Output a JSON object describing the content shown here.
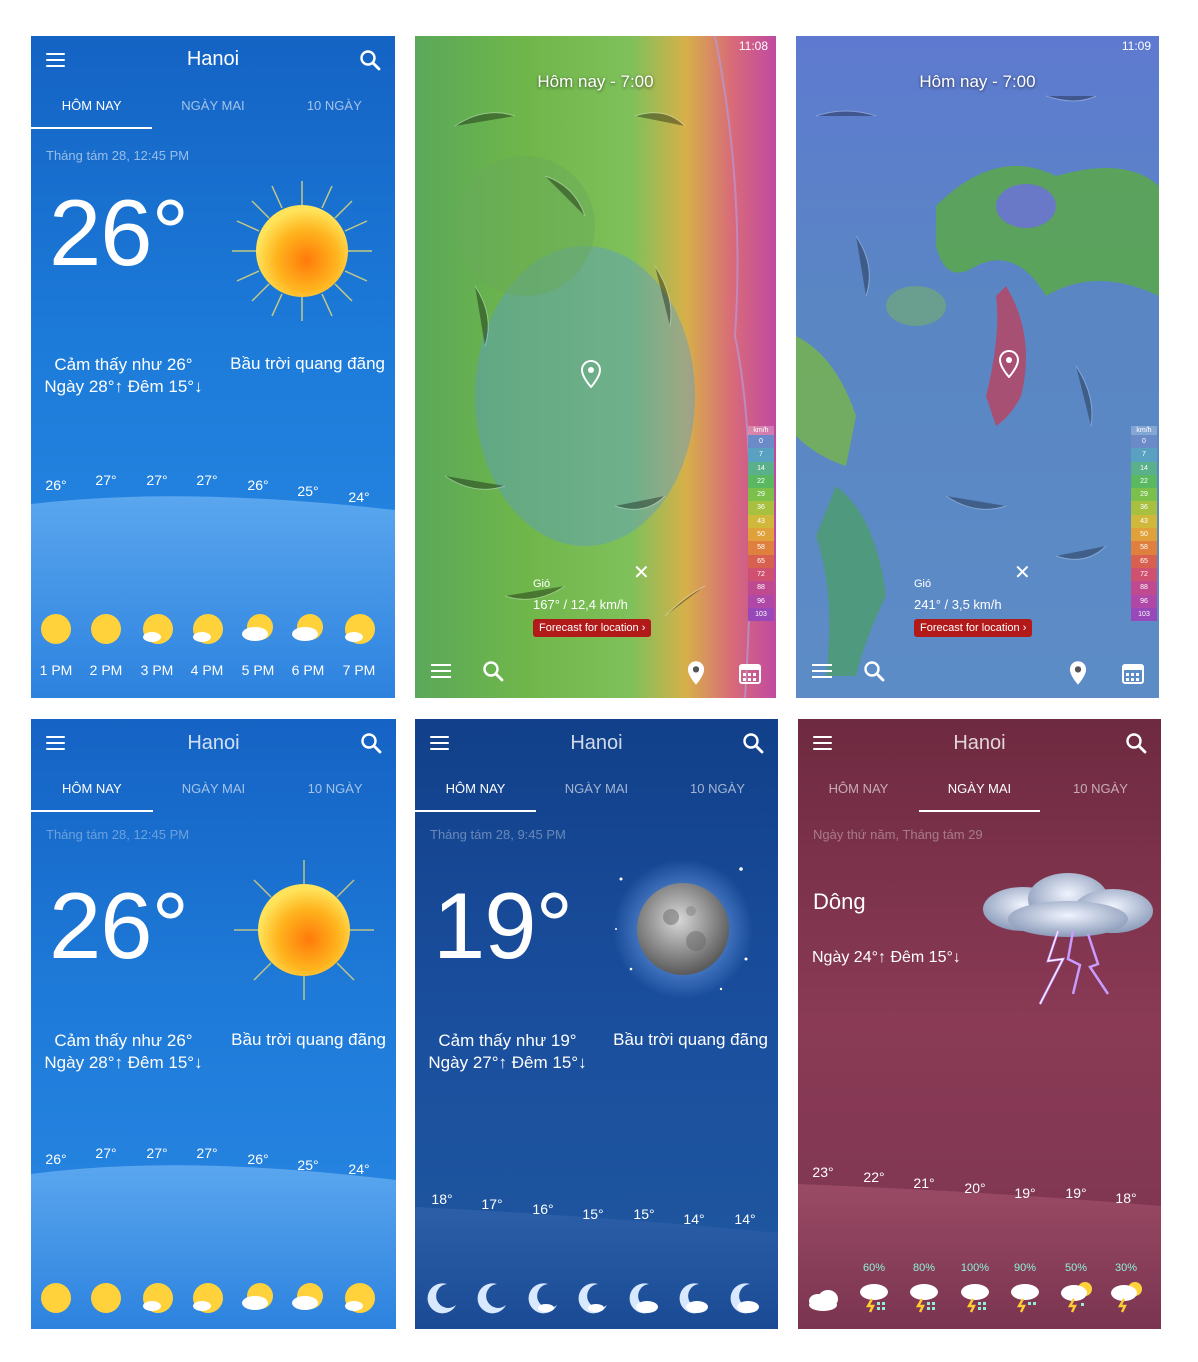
{
  "p1": {
    "title": "Hanoi",
    "tabs": [
      "HÔM NAY",
      "NGÀY MAI",
      "10 NGÀY"
    ],
    "date": "Tháng tám 28, 12:45 PM",
    "temp": "26°",
    "feels_like": "Cảm thấy như 26°",
    "hilo": "Ngày 28°↑  Đêm 15°↓",
    "condition": "Bầu trời quang đãng",
    "hour_temps": [
      "26°",
      "27°",
      "27°",
      "27°",
      "26°",
      "25°",
      "24°"
    ],
    "hours": [
      "1 PM",
      "2 PM",
      "3 PM",
      "4 PM",
      "5 PM",
      "6 PM",
      "7 PM"
    ],
    "hour_icons": [
      "sun-icon",
      "sun-icon",
      "sun-cloud-icon",
      "sun-cloud-icon",
      "cloud-sun-icon",
      "cloud-sun-icon",
      "sun-cloud-icon"
    ]
  },
  "p2": {
    "clock": "11:08",
    "title": "Hôm nay - 7:00",
    "wind_label": "Gió",
    "wind_value": "167° / 12,4 km/h",
    "forecast_button": "Forecast for location ›",
    "legend_unit": "km/h",
    "legend": [
      "0",
      "7",
      "14",
      "22",
      "29",
      "36",
      "43",
      "50",
      "58",
      "65",
      "72",
      "88",
      "96",
      "103"
    ]
  },
  "p3": {
    "clock": "11:09",
    "title": "Hôm nay - 7:00",
    "wind_label": "Gió",
    "wind_value": "241° / 3,5 km/h",
    "forecast_button": "Forecast for location ›",
    "legend_unit": "km/h",
    "legend": [
      "0",
      "7",
      "14",
      "22",
      "29",
      "36",
      "43",
      "50",
      "58",
      "65",
      "72",
      "88",
      "96",
      "103"
    ]
  },
  "p4": {
    "title": "Hanoi",
    "tabs": [
      "HÔM NAY",
      "NGÀY MAI",
      "10 NGÀY"
    ],
    "date": "Tháng tám 28, 12:45 PM",
    "temp": "26°",
    "feels_like": "Cảm thấy như 26°",
    "hilo": "Ngày 28°↑  Đêm 15°↓",
    "condition": "Bầu trời quang đãng",
    "hour_temps": [
      "26°",
      "27°",
      "27°",
      "27°",
      "26°",
      "25°",
      "24°"
    ]
  },
  "p5": {
    "title": "Hanoi",
    "tabs": [
      "HÔM NAY",
      "NGÀY MAI",
      "10 NGÀY"
    ],
    "date": "Tháng tám 28, 9:45 PM",
    "temp": "19°",
    "feels_like": "Cảm thấy như 19°",
    "hilo": "Ngày 27°↑  Đêm 15°↓",
    "condition": "Bầu trời quang đãng",
    "hour_temps": [
      "18°",
      "17°",
      "16°",
      "15°",
      "15°",
      "14°",
      "14°"
    ]
  },
  "p6": {
    "title": "Hanoi",
    "tabs": [
      "HÔM NAY",
      "NGÀY MAI",
      "10 NGÀY"
    ],
    "date": "Ngày thứ năm, Tháng tám 29",
    "condition": "Dông",
    "hilo": "Ngày 24°↑  Đêm 15°↓",
    "hour_temps": [
      "23°",
      "22°",
      "21°",
      "20°",
      "19°",
      "19°",
      "18°"
    ],
    "precip": [
      "",
      "60%",
      "80%",
      "100%",
      "90%",
      "50%",
      "30%"
    ]
  },
  "colors": {
    "day_blue": "#1e78d4",
    "night_blue": "#14428a",
    "storm_maroon": "#8a3a55",
    "forecast_red": "#b21a1a"
  }
}
